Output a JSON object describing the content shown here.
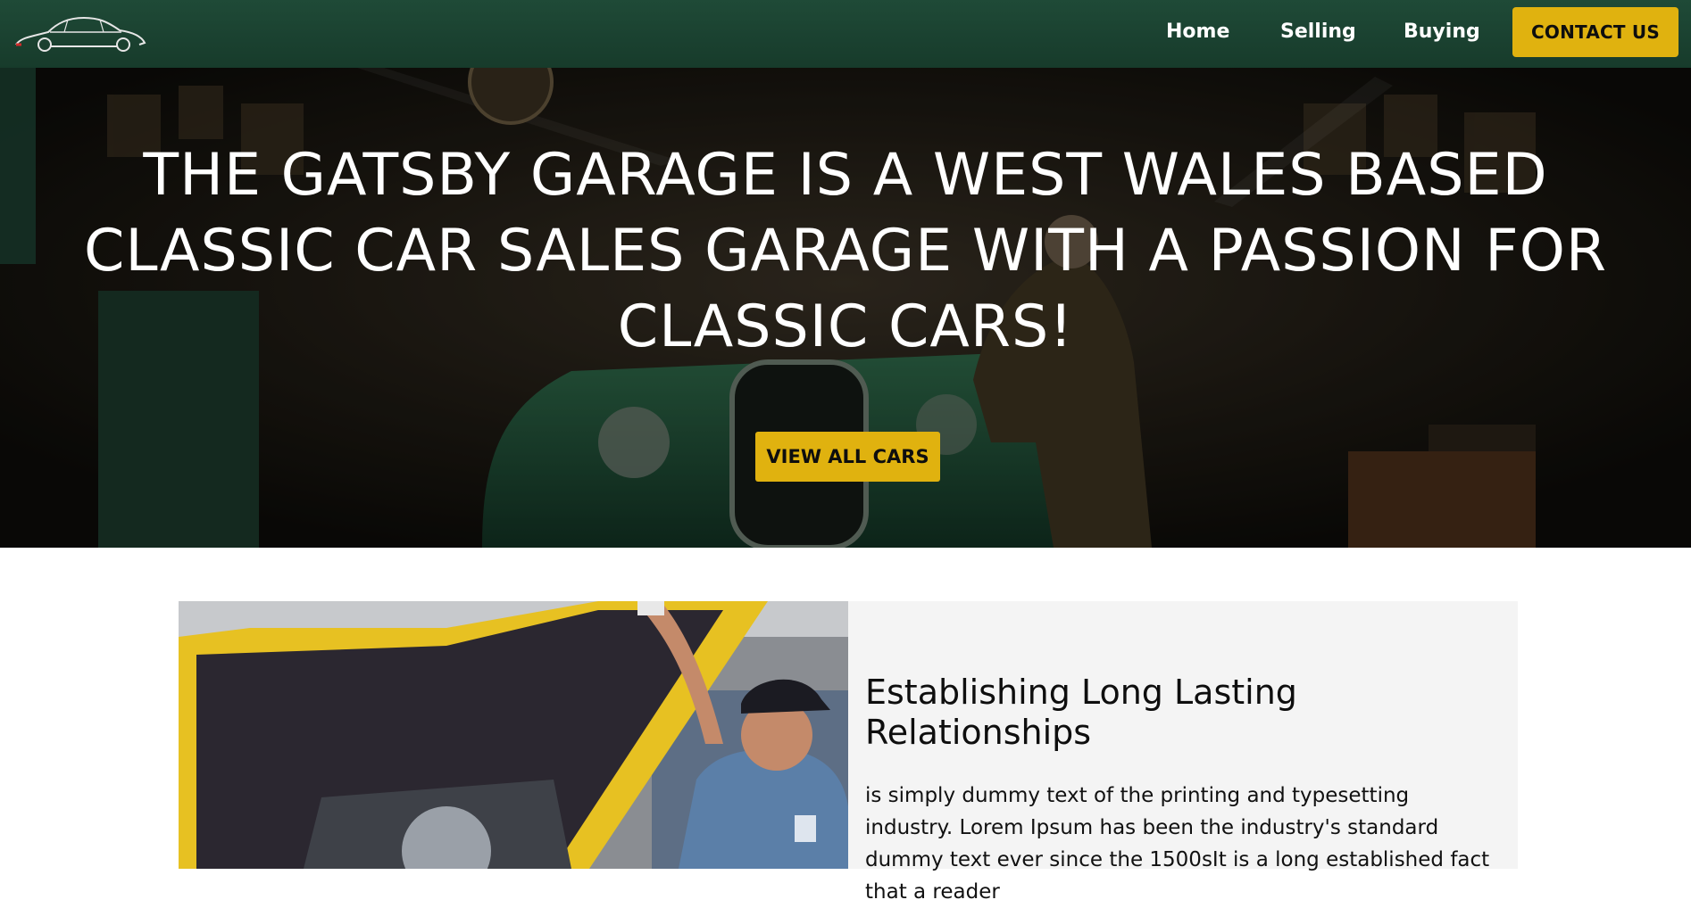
{
  "nav": {
    "logo_icon": "classic-car-outline-icon",
    "links": {
      "home": "Home",
      "selling": "Selling",
      "buying": "Buying"
    },
    "contact_label": "CONTACT US"
  },
  "hero": {
    "title": "THE GATSBY GARAGE IS A WEST WALES BASED CLASSIC CAR SALES GARAGE WITH A PASSION FOR CLASSIC CARS!",
    "cta_label": "VIEW ALL CARS"
  },
  "feature": {
    "heading": "Establishing Long Lasting Relationships",
    "body": "is simply dummy text of the printing and typesetting industry. Lorem Ipsum has been the industry's standard dummy text ever since the 1500sIt is a long established fact that a reader"
  },
  "colors": {
    "nav_bg": "#1f4a37",
    "accent": "#e0b20f",
    "card_bg": "#f4f4f4",
    "text_dark": "#0e0e0e"
  }
}
